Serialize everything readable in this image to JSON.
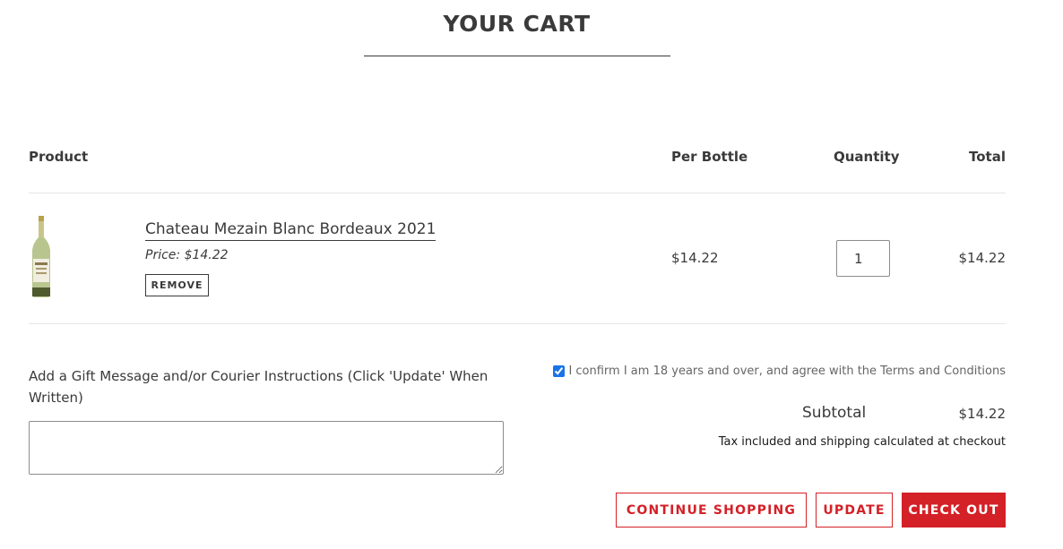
{
  "page": {
    "title": "YOUR CART"
  },
  "table": {
    "headers": {
      "product": "Product",
      "per_bottle": "Per Bottle",
      "quantity": "Quantity",
      "total": "Total"
    },
    "items": [
      {
        "name": "Chateau Mezain Blanc Bordeaux 2021",
        "price_label": "Price: $14.22",
        "remove_label": "REMOVE",
        "per_bottle": "$14.22",
        "quantity": "1",
        "total": "$14.22",
        "image_icon": "wine-bottle-icon"
      }
    ]
  },
  "gift": {
    "label": "Add a Gift Message and/or Courier Instructions (Click 'Update' When Written)",
    "value": ""
  },
  "summary": {
    "confirm_text": "I confirm I am 18 years and over, and agree with the Terms and Conditions",
    "confirm_checked": true,
    "subtotal_label": "Subtotal",
    "subtotal_value": "$14.22",
    "tax_note": "Tax included and shipping calculated at checkout"
  },
  "actions": {
    "continue_label": "CONTINUE SHOPPING",
    "update_label": "UPDATE",
    "checkout_label": "CHECK OUT"
  },
  "colors": {
    "accent": "#d42027",
    "text": "#3a3a3a",
    "divider": "#e6e6e6"
  }
}
